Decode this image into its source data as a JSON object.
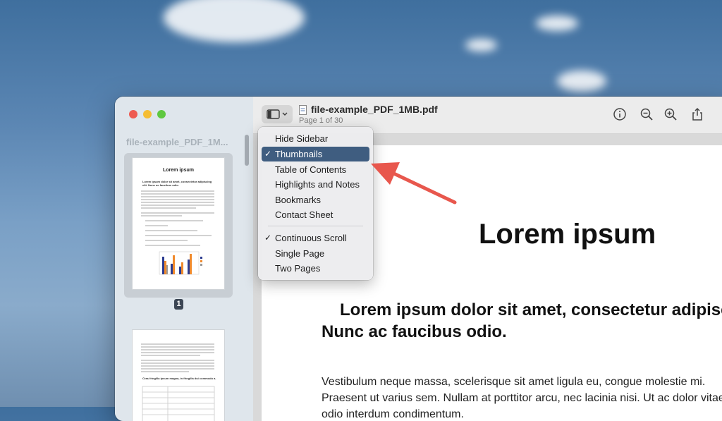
{
  "window": {
    "file_name": "file-example_PDF_1MB.pdf",
    "page_info": "Page 1 of 30"
  },
  "sidebar": {
    "title": "file-example_PDF_1M...",
    "thumbnail1": {
      "heading": "Lorem ipsum",
      "subheading": "Lorem ipsum dolor sit amet, consectetur adipiscing elit. Nunc ac faucibus odio."
    },
    "selected_page_badge": "1",
    "thumbnail2": {
      "heading": "Cras fringilla ipsum magna, in fringilla dui commodo a."
    }
  },
  "toolbar": {
    "icons": [
      "sidebar-toggle-icon",
      "info-icon",
      "zoom-out-icon",
      "zoom-in-icon",
      "share-icon",
      "markup-pen-icon",
      "rotate-icon",
      "markup-circle-icon"
    ]
  },
  "menu": {
    "items": [
      {
        "label": "Hide Sidebar",
        "checked": false,
        "selected": false
      },
      {
        "label": "Thumbnails",
        "checked": true,
        "selected": true
      },
      {
        "label": "Table of Contents",
        "checked": false,
        "selected": false
      },
      {
        "label": "Highlights and Notes",
        "checked": false,
        "selected": false
      },
      {
        "label": "Bookmarks",
        "checked": false,
        "selected": false
      },
      {
        "label": "Contact Sheet",
        "checked": false,
        "selected": false
      },
      {
        "label": "Continuous Scroll",
        "checked": true,
        "selected": false
      },
      {
        "label": "Single Page",
        "checked": false,
        "selected": false
      },
      {
        "label": "Two Pages",
        "checked": false,
        "selected": false
      }
    ],
    "check_glyph": "✓"
  },
  "document": {
    "title": "Lorem ipsum",
    "subtitle": "Lorem ipsum dolor sit amet, consectetur adipiscing elit. Nunc ac faucibus odio.",
    "body": "Vestibulum neque massa, scelerisque sit amet ligula eu, congue molestie mi. Praesent ut varius sem. Nullam at porttitor arcu, nec lacinia nisi. Ut ac dolor vitae odio interdum condimentum."
  },
  "colors": {
    "menu_highlight": "#3f5d80",
    "arrow": "#e8574d",
    "close": "#ee5b52",
    "minimize": "#f5bd33",
    "zoom": "#5fc840"
  }
}
